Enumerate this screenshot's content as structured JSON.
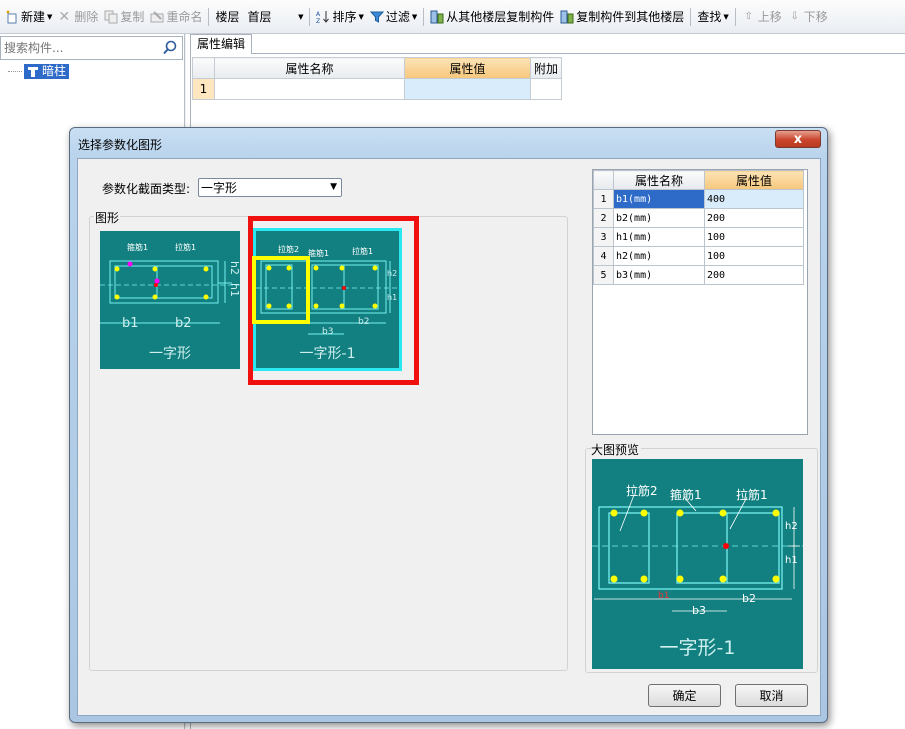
{
  "toolbar": {
    "new_label": "新建",
    "delete_label": "删除",
    "copy_label": "复制",
    "rename_label": "重命名",
    "floor_label": "楼层",
    "floor_value": "首层",
    "sort_label": "排序",
    "filter_label": "过滤",
    "copy_from_floor_label": "从其他楼层复制构件",
    "copy_to_floor_label": "复制构件到其他楼层",
    "find_label": "查找",
    "move_up_label": "上移",
    "move_down_label": "下移"
  },
  "left_panel": {
    "search_placeholder": "搜索构件...",
    "tree_items": [
      {
        "label": "暗柱"
      }
    ]
  },
  "property_panel": {
    "tab_label": "属性编辑",
    "columns": [
      "属性名称",
      "属性值",
      "附加"
    ],
    "rows": [
      {
        "num": "1",
        "name": "",
        "value": "",
        "extra": ""
      }
    ]
  },
  "dialog": {
    "title": "选择参数化图形",
    "close_label": "x",
    "section_type_label": "参数化截面类型:",
    "section_type_value": "一字形",
    "shapes_group_label": "图形",
    "shapes": [
      {
        "caption": "一字形",
        "labels": {
          "stirrup": "箍筋1",
          "tie": "拉筋1",
          "b1": "b1",
          "b2": "b2",
          "h1": "h1",
          "h2": "h2"
        }
      },
      {
        "caption": "一字形-1",
        "labels": {
          "tie2": "拉筋2",
          "stirrup": "箍筋1",
          "tie1": "拉筋1",
          "b3": "b3",
          "b2": "b2",
          "h1": "h1",
          "h2": "h2"
        }
      }
    ],
    "param_table": {
      "columns": [
        "属性名称",
        "属性值"
      ],
      "rows": [
        {
          "num": "1",
          "name": "b1(mm)",
          "value": "400"
        },
        {
          "num": "2",
          "name": "b2(mm)",
          "value": "200"
        },
        {
          "num": "3",
          "name": "h1(mm)",
          "value": "100"
        },
        {
          "num": "4",
          "name": "h2(mm)",
          "value": "100"
        },
        {
          "num": "5",
          "name": "b3(mm)",
          "value": "200"
        }
      ]
    },
    "preview_label": "大图预览",
    "preview": {
      "caption": "一字形-1",
      "tie2": "拉筋2",
      "stirrup": "箍筋1",
      "tie1": "拉筋1",
      "h2": "h2",
      "h1": "h1",
      "b3": "b3",
      "b2": "b2",
      "b1": "b1"
    },
    "ok_label": "确定",
    "cancel_label": "取消"
  },
  "colors": {
    "diagram_bg": "#128080",
    "rebar_dot": "#ffff00",
    "selection_red": "#f01010",
    "selection_yellow": "#ffff00",
    "header_orange": "#f6c77c",
    "selection_blue": "#2e6bc8"
  }
}
